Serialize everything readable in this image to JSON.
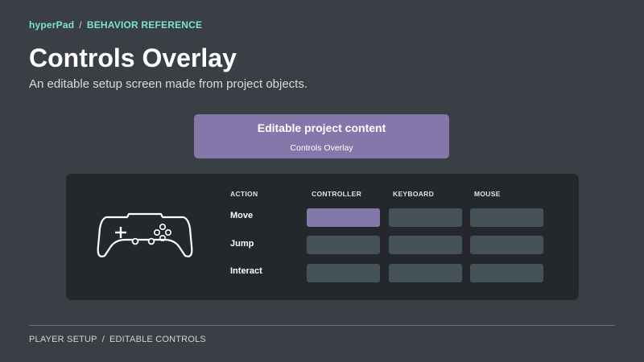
{
  "breadcrumb": {
    "app": "hyperPad",
    "separator": "/",
    "section": "BEHAVIOR REFERENCE"
  },
  "page": {
    "title": "Controls Overlay",
    "subtitle": "An editable setup screen made from project objects."
  },
  "content_card": {
    "title": "Editable project content",
    "subtitle": "Controls Overlay"
  },
  "controls": {
    "icon": "gamepad-icon",
    "columns": [
      "ACTION",
      "CONTROLLER",
      "KEYBOARD",
      "MOUSE"
    ],
    "rows": [
      {
        "action": "Move",
        "active_binding": "CONTROLLER"
      },
      {
        "action": "Jump",
        "active_binding": ""
      },
      {
        "action": "Interact",
        "active_binding": ""
      }
    ]
  },
  "footer": {
    "left": "PLAYER SETUP",
    "separator": "/",
    "right": "EDITABLE CONTROLS"
  },
  "colors": {
    "background": "#3a3f45",
    "accent_teal": "#7fe3c9",
    "accent_purple": "#8477aa",
    "panel": "#24282c",
    "slot": "#46525a"
  }
}
